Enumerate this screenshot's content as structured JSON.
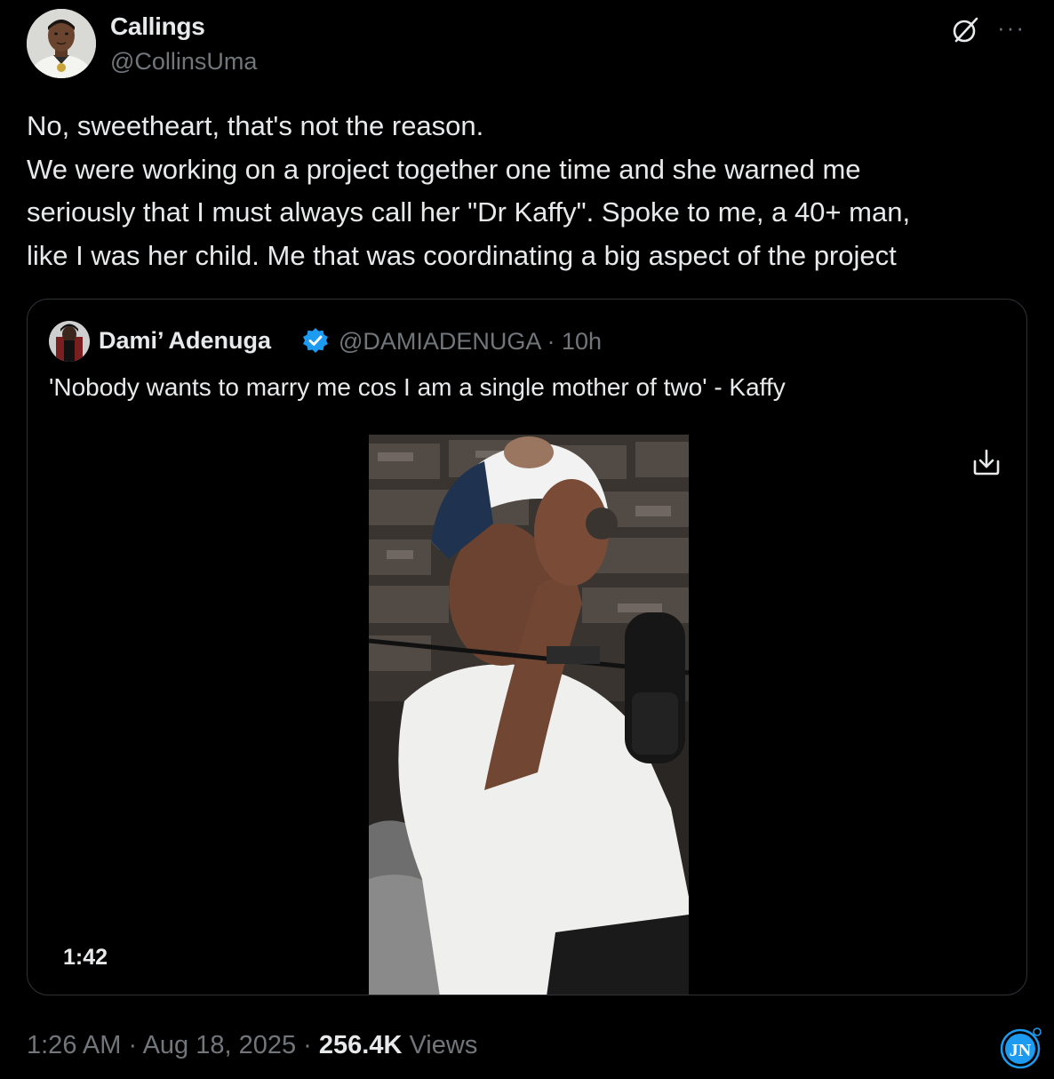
{
  "author": {
    "display_name": "Callings",
    "handle": "@CollinsUma"
  },
  "header_icons": {
    "grok": "grok-icon",
    "more": "more-icon",
    "more_glyph": "···"
  },
  "tweet": {
    "lines": [
      "No, sweetheart, that's not the reason.",
      "We were working on a project together one time and she warned me",
      "seriously that I must always call her \"Dr Kaffy\". Spoke to me, a 40+ man,",
      "like I was her child. Me that was coordinating a big aspect of the project"
    ]
  },
  "quoted_tweet": {
    "display_name": "Dami’ Adenuga",
    "verified": true,
    "handle": "@DAMIADENUGA",
    "separator": " · ",
    "time_ago": "10h",
    "text": "'Nobody wants to marry me cos I am a single mother of two' - Kaffy",
    "video": {
      "duration": "1:42"
    }
  },
  "footer": {
    "time": "1:26 AM",
    "separator": " · ",
    "date": "Aug 18, 2025",
    "views_count": "256.4K",
    "views_label": "Views"
  },
  "watermark_text": "JN",
  "colors": {
    "background": "#000000",
    "primary_text": "#e7e9ea",
    "secondary_text": "#71767b",
    "border": "#2f3336",
    "verified_blue": "#1d9bf0"
  }
}
